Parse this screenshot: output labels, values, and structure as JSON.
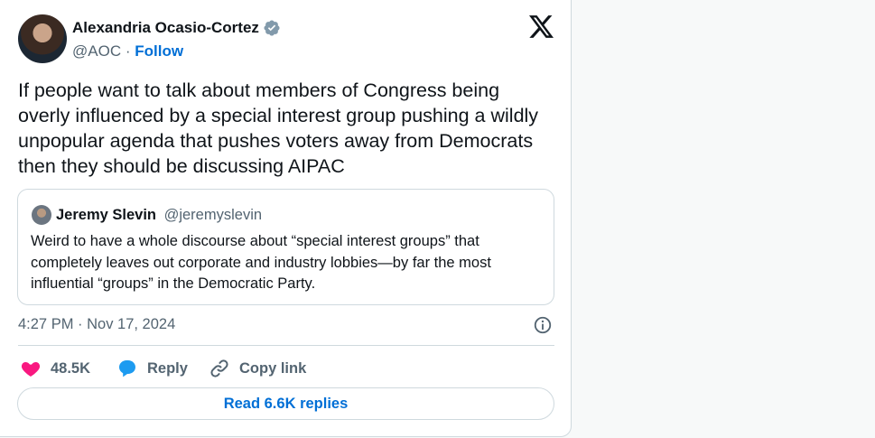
{
  "author": {
    "name": "Alexandria Ocasio-Cortez",
    "handle": "@AOC",
    "separator": "·",
    "follow_label": "Follow",
    "verified_icon": "verified-badge-icon"
  },
  "tweet": {
    "text": "If people want to talk about members of Congress being overly influenced by a special interest group pushing a wildly unpopular agenda that pushes voters away from Democrats then they should be discussing AIPAC",
    "timestamp": "4:27 PM · Nov 17, 2024"
  },
  "quoted_tweet": {
    "name": "Jeremy Slevin",
    "handle": "@jeremyslevin",
    "text": "Weird to have a whole discourse about “special interest groups” that completely leaves out corporate and industry lobbies—by far the most influential “groups” in the Democratic Party."
  },
  "actions": {
    "likes_count": "48.5K",
    "reply_label": "Reply",
    "copy_link_label": "Copy link",
    "read_replies_label": "Read 6.6K replies"
  },
  "colors": {
    "accent": "#006fd6",
    "like": "#f91880",
    "reply": "#1d9bf0",
    "muted": "#536471",
    "border": "#cfd9de"
  },
  "icons": [
    "x-logo-icon",
    "info-icon",
    "heart-icon",
    "reply-bubble-icon",
    "link-icon"
  ]
}
